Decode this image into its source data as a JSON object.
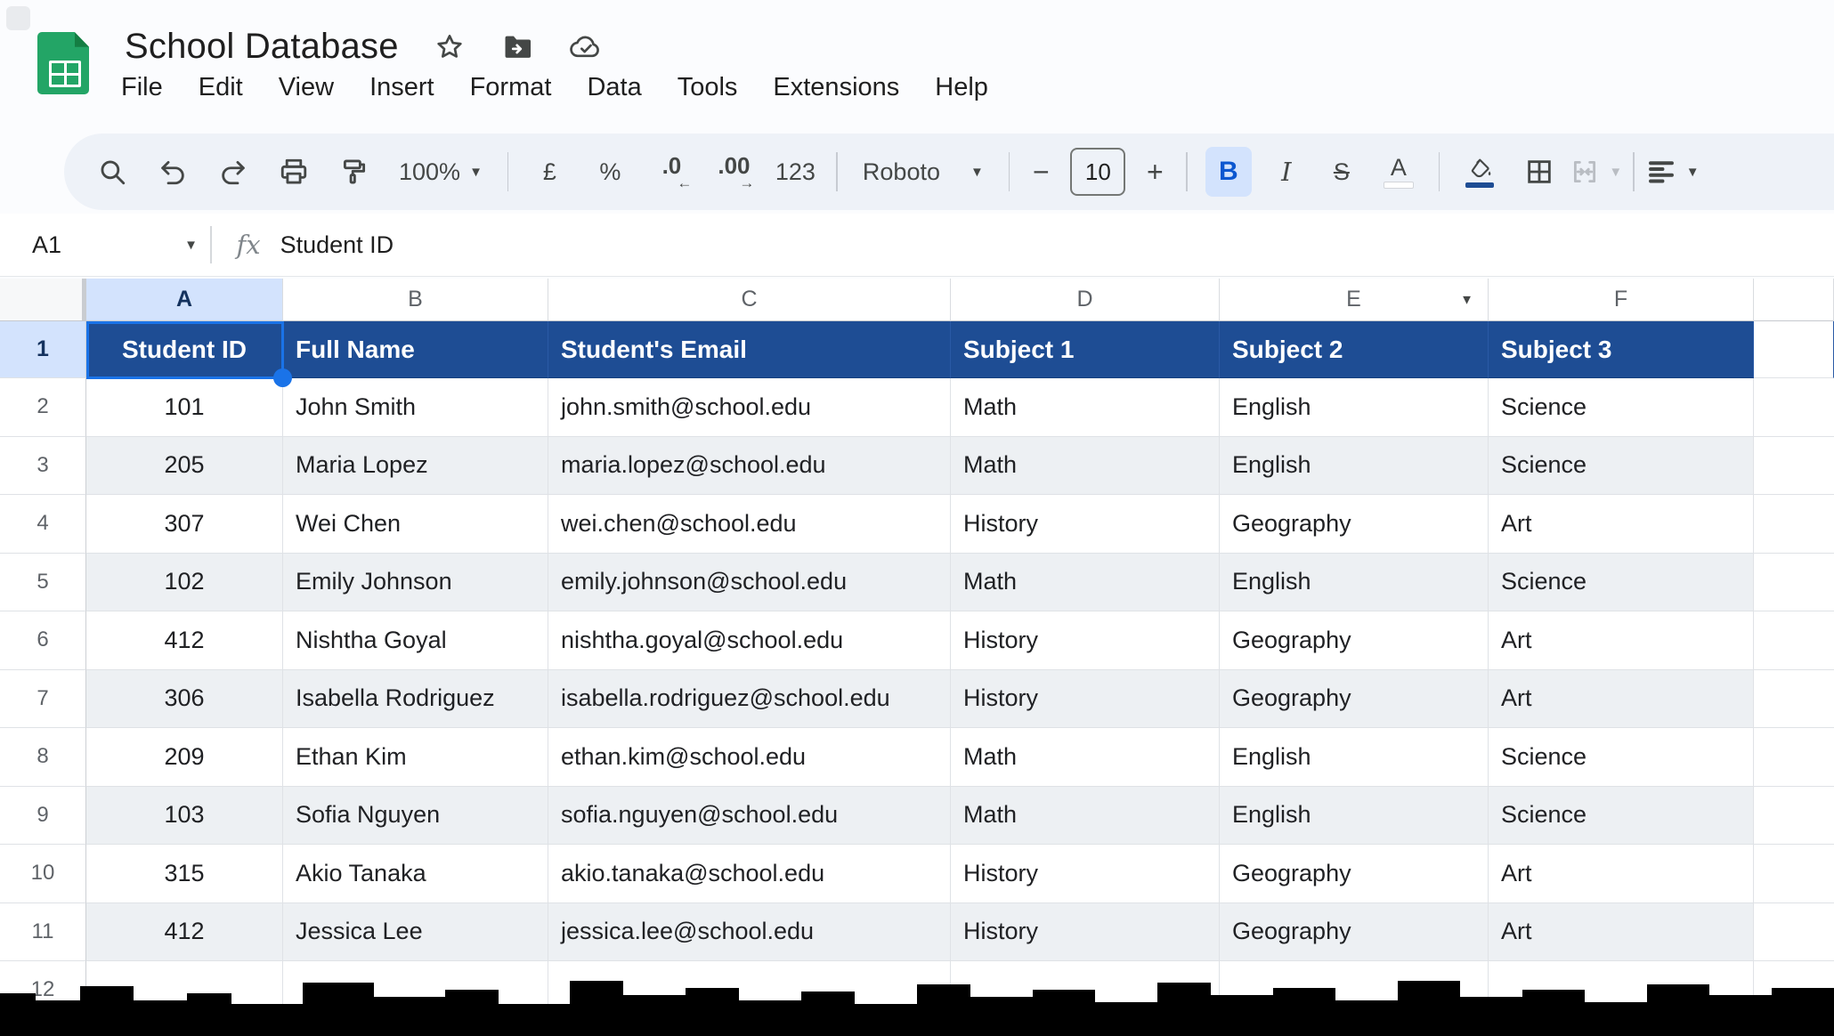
{
  "app": {
    "title": "School Database"
  },
  "menu": {
    "items": [
      "File",
      "Edit",
      "View",
      "Insert",
      "Format",
      "Data",
      "Tools",
      "Extensions",
      "Help"
    ]
  },
  "glyphs": {
    "dropdown": "▼"
  },
  "toolbar": {
    "zoom": "100%",
    "currency": "£",
    "percent": "%",
    "decrease_decimal": ".0",
    "decrease_arrow": "←",
    "increase_decimal": ".00",
    "increase_arrow": "→",
    "plain_number_format": "123",
    "font_name": "Roboto",
    "minus": "−",
    "font_size": "10",
    "plus": "+",
    "bold": "B",
    "italic": "I",
    "strikethrough": "S",
    "text_color": "A"
  },
  "formula_bar": {
    "cell_ref": "A1",
    "fx": "fx",
    "value": "Student ID"
  },
  "grid": {
    "column_letters": [
      "A",
      "B",
      "C",
      "D",
      "E",
      "F"
    ],
    "header_row": {
      "number": "1",
      "cells": [
        "Student ID",
        "Full Name",
        "Student's Email",
        "Subject 1",
        "Subject 2",
        "Subject 3"
      ]
    },
    "rows": [
      {
        "number": "2",
        "cells": [
          "101",
          "John Smith",
          "john.smith@school.edu",
          "Math",
          "English",
          "Science"
        ]
      },
      {
        "number": "3",
        "cells": [
          "205",
          "Maria Lopez",
          "maria.lopez@school.edu",
          "Math",
          "English",
          "Science"
        ]
      },
      {
        "number": "4",
        "cells": [
          "307",
          "Wei Chen",
          "wei.chen@school.edu",
          "History",
          "Geography",
          "Art"
        ]
      },
      {
        "number": "5",
        "cells": [
          "102",
          "Emily Johnson",
          "emily.johnson@school.edu",
          "Math",
          "English",
          "Science"
        ]
      },
      {
        "number": "6",
        "cells": [
          "412",
          "Nishtha Goyal",
          "nishtha.goyal@school.edu",
          "History",
          "Geography",
          "Art"
        ]
      },
      {
        "number": "7",
        "cells": [
          "306",
          "Isabella Rodriguez",
          "isabella.rodriguez@school.edu",
          "History",
          "Geography",
          "Art"
        ]
      },
      {
        "number": "8",
        "cells": [
          "209",
          "Ethan Kim",
          "ethan.kim@school.edu",
          "Math",
          "English",
          "Science"
        ]
      },
      {
        "number": "9",
        "cells": [
          "103",
          "Sofia Nguyen",
          "sofia.nguyen@school.edu",
          "Math",
          "English",
          "Science"
        ]
      },
      {
        "number": "10",
        "cells": [
          "315",
          "Akio Tanaka",
          "akio.tanaka@school.edu",
          "History",
          "Geography",
          "Art"
        ]
      },
      {
        "number": "11",
        "cells": [
          "412",
          "Jessica Lee",
          "jessica.lee@school.edu",
          "History",
          "Geography",
          "Art"
        ]
      },
      {
        "number": "12",
        "cells": [
          "",
          "",
          "",
          "",
          "",
          ""
        ]
      }
    ]
  },
  "colors": {
    "header_row_fill": "#1e4d94",
    "band_fill": "#edf0f3",
    "selection_blue": "#1a73e8",
    "selected_header_fill": "#d3e3fd",
    "active_toggle_fill": "#d3e3fd",
    "toolbar_fill": "#eef2f8"
  }
}
